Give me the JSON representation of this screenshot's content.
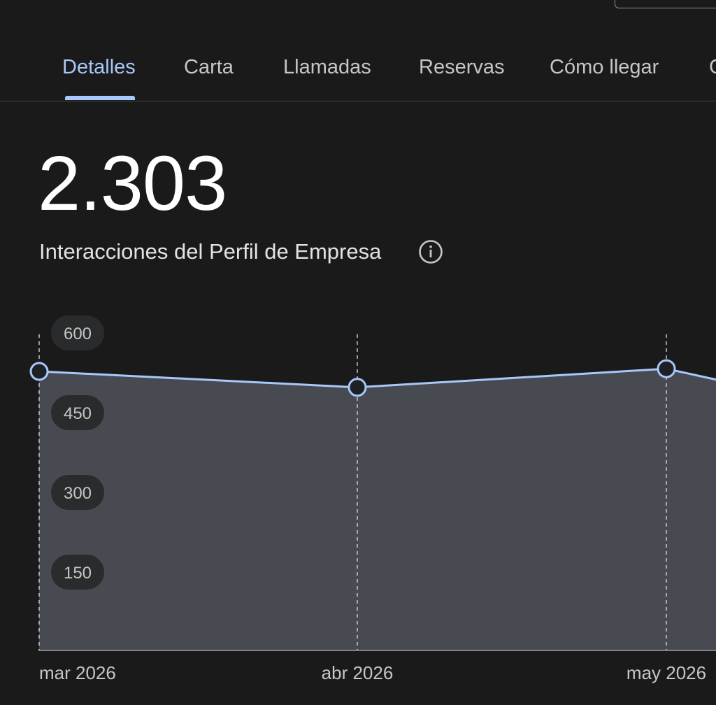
{
  "tabs": [
    {
      "label": "Detalles",
      "active": true
    },
    {
      "label": "Carta",
      "active": false
    },
    {
      "label": "Llamadas",
      "active": false
    },
    {
      "label": "Reservas",
      "active": false
    },
    {
      "label": "Cómo llegar",
      "active": false
    },
    {
      "label": "C",
      "active": false
    }
  ],
  "summary": {
    "total": "2.303",
    "label": "Interacciones del Perfil de Empresa",
    "info_icon": "info-icon"
  },
  "colors": {
    "accent": "#a8c7fa",
    "line": "#a8c7fa",
    "area_fill": "#474b51",
    "background": "#1a1a1b"
  },
  "chart_data": {
    "type": "area",
    "categories": [
      "mar 2026",
      "abr 2026",
      "may 2026"
    ],
    "x_visible_labels": [
      "mar 2026",
      "abr 2026",
      "may 2026"
    ],
    "series": [
      {
        "values": [
          525,
          495,
          530,
          505
        ]
      }
    ],
    "ylim": [
      0,
      600
    ],
    "yticks": [
      600,
      450,
      300,
      150
    ],
    "grid": "vertical-dashed"
  }
}
